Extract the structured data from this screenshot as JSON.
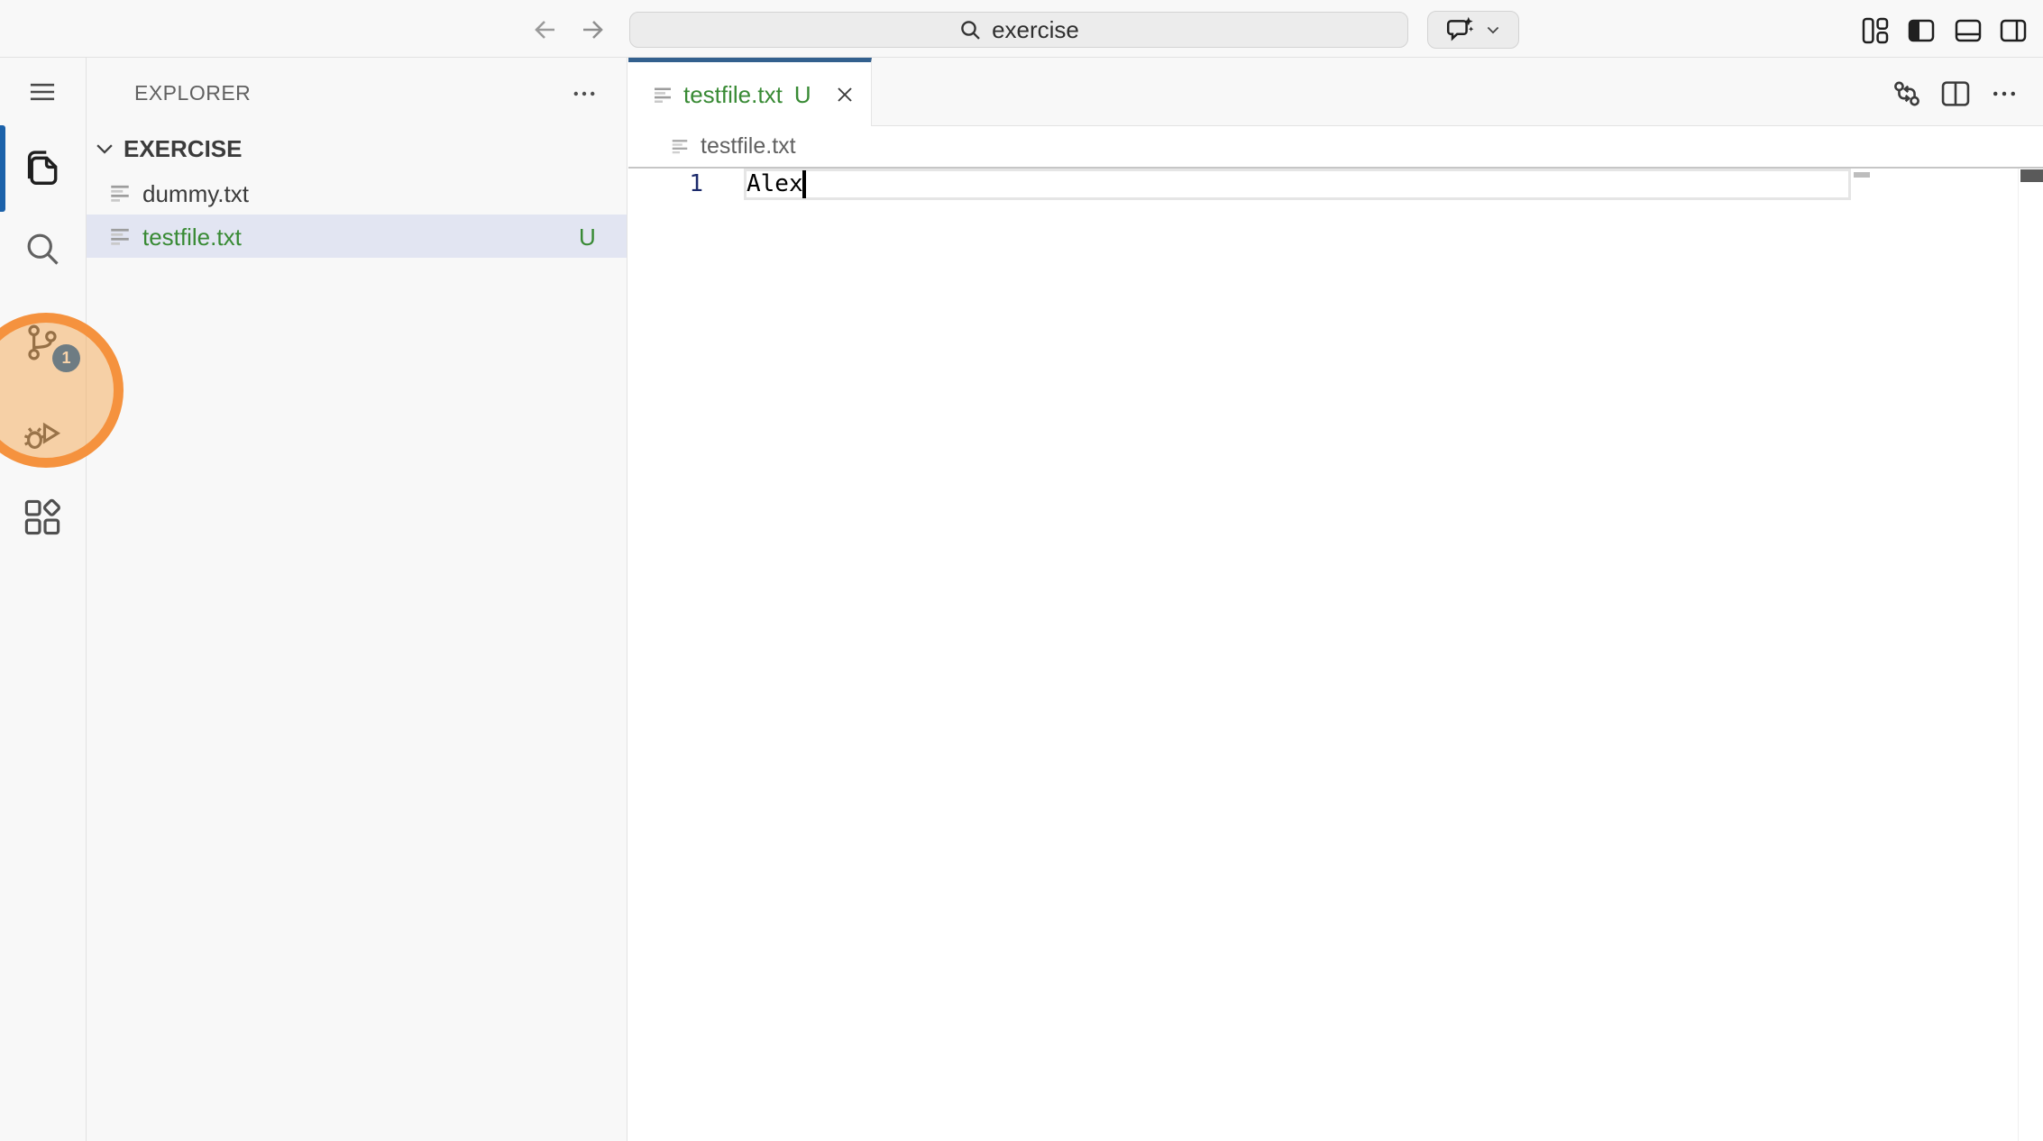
{
  "titlebar": {
    "command_center_query": "exercise"
  },
  "activity_bar": {
    "source_control_badge": "1",
    "items": [
      "menu",
      "explorer",
      "search",
      "source-control",
      "run-and-debug",
      "extensions"
    ],
    "active_item": "explorer"
  },
  "explorer": {
    "title": "EXPLORER",
    "section_label": "EXERCISE",
    "files": [
      {
        "name": "dummy.txt",
        "git_badge": "",
        "selected": false
      },
      {
        "name": "testfile.txt",
        "git_badge": "U",
        "selected": true
      }
    ]
  },
  "editor": {
    "tab": {
      "label": "testfile.txt",
      "git_badge": "U",
      "active": true
    },
    "breadcrumb_file": "testfile.txt",
    "lines": [
      {
        "number": "1",
        "text": "Alex"
      }
    ],
    "cursor": {
      "line": 1,
      "after_text": "Alex"
    }
  },
  "annotation": {
    "shape": "circle-highlight",
    "target": "source-control-activity-item",
    "ring_color": "#f5923e"
  },
  "icons": {
    "search-icon": "magnifier",
    "copilot-chat-icon": "speech-bubble-with-sparkle",
    "files-icon": "two-stacked-documents",
    "source-control-icon": "git-branch-nodes",
    "debug-icon": "bug-with-play-triangle",
    "extensions-icon": "three-squares-plus-diamond",
    "txt-file-icon": "gray-text-lines"
  },
  "colors": {
    "accent_blue": "#005fb8",
    "tab_active_border": "#33608e",
    "untracked_green": "#388a34",
    "annotation_orange": "#f5923e",
    "chrome_bg": "#f8f8f8",
    "selection_row": "#e2e5f2"
  }
}
